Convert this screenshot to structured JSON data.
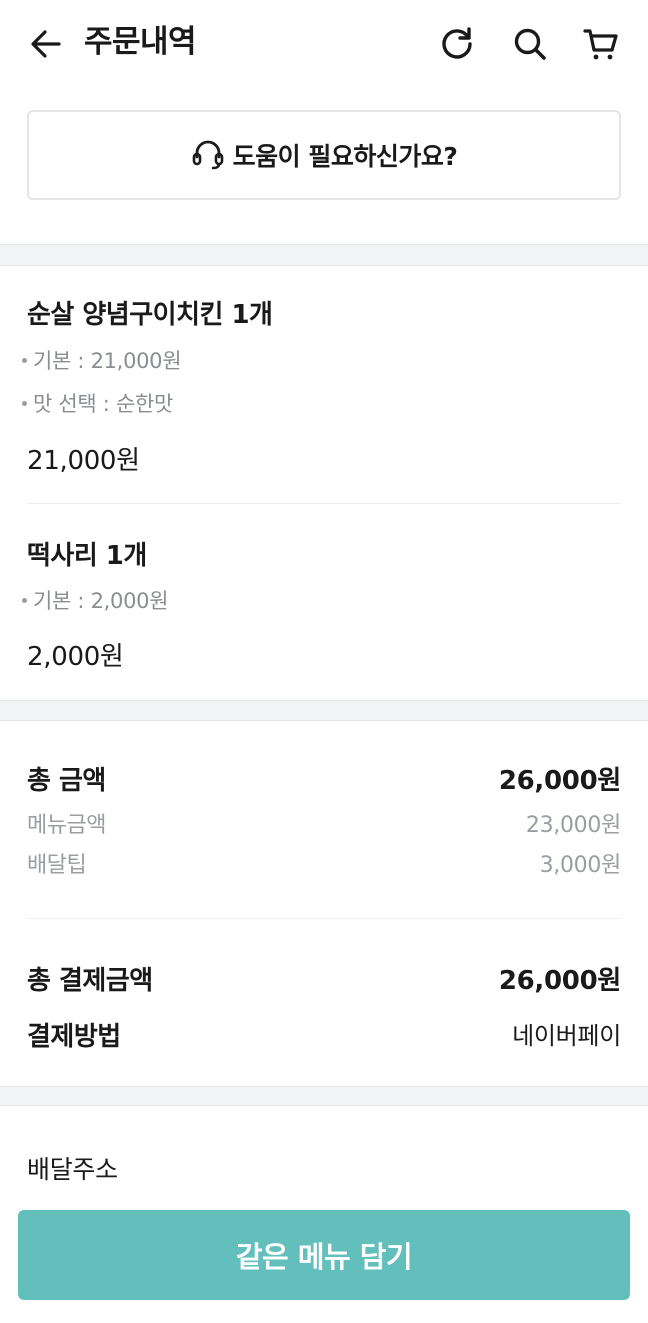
{
  "header": {
    "title": "주문내역",
    "back_icon": "arrow-left-icon",
    "refresh_icon": "refresh-icon",
    "search_icon": "search-icon",
    "cart_icon": "cart-icon"
  },
  "help": {
    "icon": "headset-icon",
    "label": "도움이 필요하신가요?"
  },
  "items": [
    {
      "name": "순살 양념구이치킨 1개",
      "options": [
        "기본 : 21,000원",
        "맛 선택 : 순한맛"
      ],
      "price": "21,000원"
    },
    {
      "name": "떡사리 1개",
      "options": [
        "기본 : 2,000원"
      ],
      "price": "2,000원"
    }
  ],
  "summary": {
    "total_label": "총 금액",
    "total_value": "26,000원",
    "menu_label": "메뉴금액",
    "menu_value": "23,000원",
    "delivery_label": "배달팁",
    "delivery_value": "3,000원",
    "payment_total_label": "총 결제금액",
    "payment_total_value": "26,000원",
    "method_label": "결제방법",
    "method_value": "네이버페이"
  },
  "address": {
    "label": "배달주소"
  },
  "cta": {
    "label": "같은 메뉴 담기"
  },
  "colors": {
    "accent": "#62bfbb",
    "muted": "#9a9da2",
    "band": "#f3f4f6"
  }
}
